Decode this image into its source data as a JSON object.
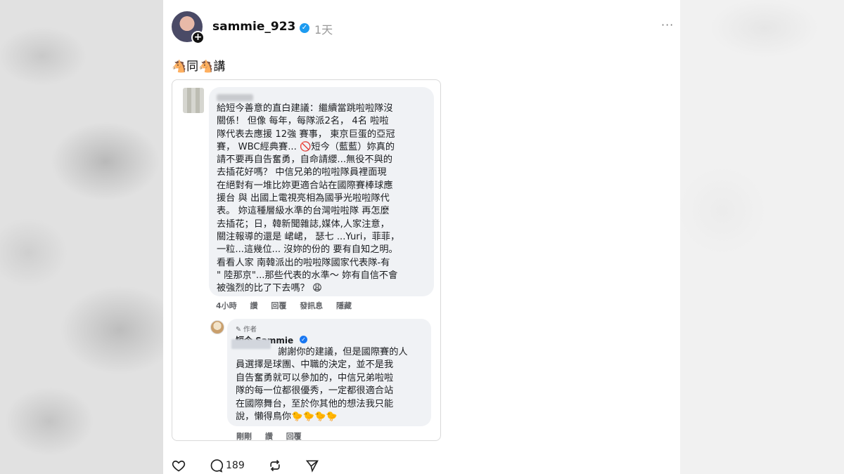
{
  "post": {
    "username": "sammie_923",
    "time": "1天",
    "more": "···",
    "caption": "🐴同🐴講"
  },
  "comment": {
    "text": "給短今善意的直白建議：繼續當跳啦啦隊沒\n關係！ 但像 每年，每隊派2名， 4名 啦啦\n隊代表去應援 12強 賽事， 東京巨蛋的亞冠\n賽， WBC經典賽... 🚫短今（藍藍）妳真的\n請不要再自告奮勇，自命請纓...無役不與的\n去插花好嗎？ 中信兄弟的啦啦隊員裡面現\n在絕對有一堆比妳更適合站在國際賽棒球應\n援台 與 出國上電視亮相為國爭光啦啦隊代\n表。 妳這種層級水準的台灣啦啦隊 再怎麼\n去插花；日，韓新聞雜誌,媒体,人家注意，\n關注報導的還是 峮峮， 瑟七 ...Yuri，菲菲，\n一粒...這幾位... 沒妳的份的 要有自知之明。\n看看人家 南韓派出的啦啦隊國家代表隊-有\n\" 陸那京\"...那些代表的水準～ 妳有自信不會\n被強烈的比了下去嗎？ 😩",
    "meta": [
      "4小時",
      "讚",
      "回覆",
      "發訊息",
      "隱藏"
    ]
  },
  "reply": {
    "author_tag": "✎ 作者",
    "name": "短今 Sammie",
    "text": "謝謝你的建議，但是國際賽的人\n員選擇是球團、中職的決定，並不是我\n自告奮勇就可以參加的，中信兄弟啦啦\n隊的每一位都很優秀，一定都很適合站\n在國際舞台，至於你其他的想法我只能\n說，懶得鳥你🐤🐤🐤🐤",
    "meta": [
      "剛剛",
      "讚",
      "回覆"
    ]
  },
  "actions": {
    "reply_count": "189"
  },
  "colors": {
    "verified": "#1d9bf0",
    "bubble_bg": "#f0f2f5",
    "muted_text": "#65676b"
  }
}
